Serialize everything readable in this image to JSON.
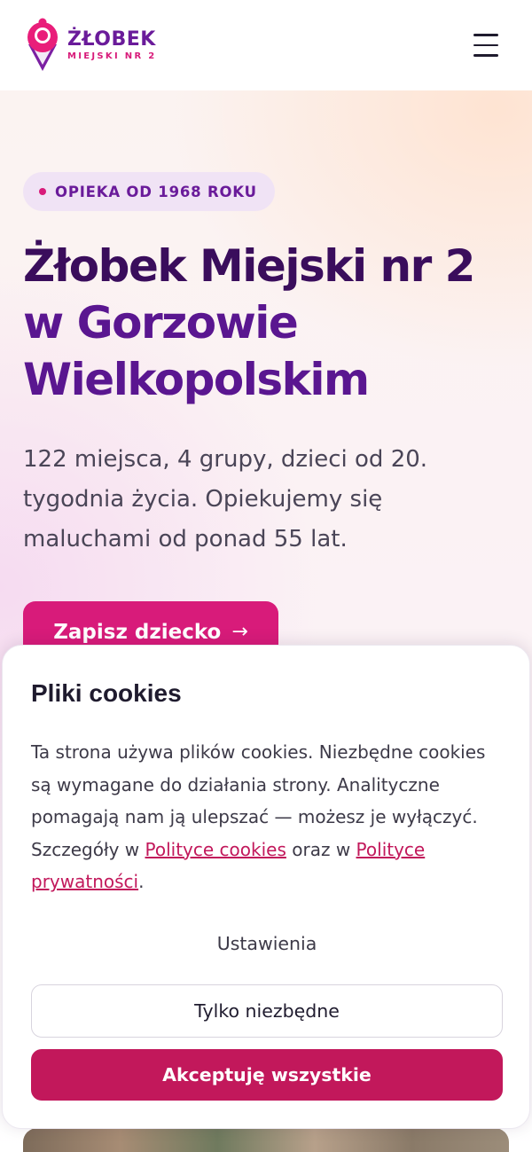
{
  "header": {
    "logo_title": "ŻŁOBEK",
    "logo_subtitle": "MIEJSKI NR 2",
    "menu_icon": "hamburger-menu-icon"
  },
  "hero": {
    "badge": "OPIEKA OD 1968 ROKU",
    "title_line1": "Żłobek Miejski nr 2",
    "title_line2": "w Gorzowie",
    "title_line3": "Wielkopolskim",
    "description": "122 miejsca, 4 grupy, dzieci od 20. tygodnia życia. Opiekujemy się maluchami od ponad 55 lat.",
    "cta_label": "Zapisz dziecko",
    "cta_icon": "arrow-right-icon"
  },
  "cookie_banner": {
    "title": "Pliki cookies",
    "text_before": "Ta strona używa plików cookies. Niezbędne cookies są wymagane do działania strony. Analityczne pomagają nam ją ulepszać — możesz je wyłączyć. Szczegóły w ",
    "link_cookie_policy": "Polityce cookies",
    "text_between": " oraz w ",
    "link_privacy_policy": "Polityce prywatności",
    "text_after": ".",
    "settings_label": "Ustawienia",
    "necessary_only_label": "Tylko niezbędne",
    "accept_all_label": "Akceptuję wszystkie"
  },
  "colors": {
    "brand_purple": "#6a1b9a",
    "brand_pink": "#d81b7a",
    "accept_button": "#c2185b",
    "title_dark": "#3a0d5c"
  }
}
